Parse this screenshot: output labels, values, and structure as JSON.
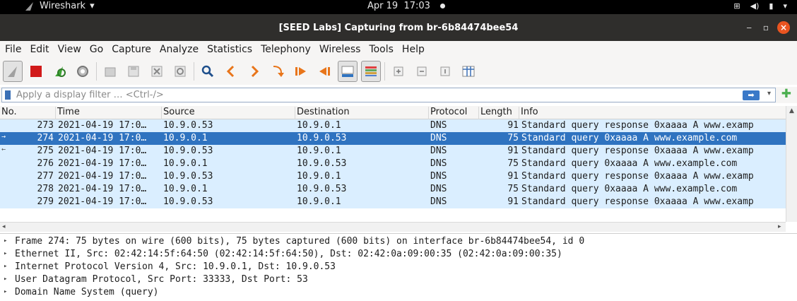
{
  "topbar": {
    "app_name": "Wireshark",
    "date": "Apr 19",
    "time": "17:03"
  },
  "window": {
    "title": "[SEED Labs] Capturing from br-6b84474bee54"
  },
  "menu": [
    "File",
    "Edit",
    "View",
    "Go",
    "Capture",
    "Analyze",
    "Statistics",
    "Telephony",
    "Wireless",
    "Tools",
    "Help"
  ],
  "toolbar": {
    "icons": [
      "shark-fin-start-icon",
      "stop-capture-icon",
      "restart-capture-icon",
      "capture-options-icon",
      "open-file-icon",
      "save-file-icon",
      "close-file-icon",
      "reload-file-icon",
      "find-packet-icon",
      "go-back-icon",
      "go-forward-icon",
      "go-to-packet-icon",
      "go-first-icon",
      "go-last-icon",
      "autoscroll-icon",
      "colorize-icon",
      "zoom-in-icon",
      "zoom-out-icon",
      "zoom-normal-icon",
      "resize-columns-icon"
    ]
  },
  "filter": {
    "placeholder": "Apply a display filter … <Ctrl-/>"
  },
  "packet_list": {
    "columns": [
      "No.",
      "Time",
      "Source",
      "Destination",
      "Protocol",
      "Length",
      "Info"
    ],
    "rows": [
      {
        "no": "273",
        "time": "2021-04-19 17:0…",
        "src": "10.9.0.53",
        "dst": "10.9.0.1",
        "proto": "DNS",
        "len": "91",
        "info": "Standard query response 0xaaaa A www.examp"
      },
      {
        "no": "274",
        "time": "2021-04-19 17:0…",
        "src": "10.9.0.1",
        "dst": "10.9.0.53",
        "proto": "DNS",
        "len": "75",
        "info": "Standard query 0xaaaa A www.example.com"
      },
      {
        "no": "275",
        "time": "2021-04-19 17:0…",
        "src": "10.9.0.53",
        "dst": "10.9.0.1",
        "proto": "DNS",
        "len": "91",
        "info": "Standard query response 0xaaaa A www.examp"
      },
      {
        "no": "276",
        "time": "2021-04-19 17:0…",
        "src": "10.9.0.1",
        "dst": "10.9.0.53",
        "proto": "DNS",
        "len": "75",
        "info": "Standard query 0xaaaa A www.example.com"
      },
      {
        "no": "277",
        "time": "2021-04-19 17:0…",
        "src": "10.9.0.53",
        "dst": "10.9.0.1",
        "proto": "DNS",
        "len": "91",
        "info": "Standard query response 0xaaaa A www.examp"
      },
      {
        "no": "278",
        "time": "2021-04-19 17:0…",
        "src": "10.9.0.1",
        "dst": "10.9.0.53",
        "proto": "DNS",
        "len": "75",
        "info": "Standard query 0xaaaa A www.example.com"
      },
      {
        "no": "279",
        "time": "2021-04-19 17:0…",
        "src": "10.9.0.53",
        "dst": "10.9.0.1",
        "proto": "DNS",
        "len": "91",
        "info": "Standard query response 0xaaaa A www.examp"
      }
    ],
    "selected_no": "274"
  },
  "details": [
    "Frame 274: 75 bytes on wire (600 bits), 75 bytes captured (600 bits) on interface br-6b84474bee54, id 0",
    "Ethernet II, Src: 02:42:14:5f:64:50 (02:42:14:5f:64:50), Dst: 02:42:0a:09:00:35 (02:42:0a:09:00:35)",
    "Internet Protocol Version 4, Src: 10.9.0.1, Dst: 10.9.0.53",
    "User Datagram Protocol, Src Port: 33333, Dst Port: 53",
    "Domain Name System (query)"
  ],
  "colors": {
    "row_bg": "#daeeff",
    "selected_bg": "#2f73c0",
    "accent": "#e95420"
  }
}
